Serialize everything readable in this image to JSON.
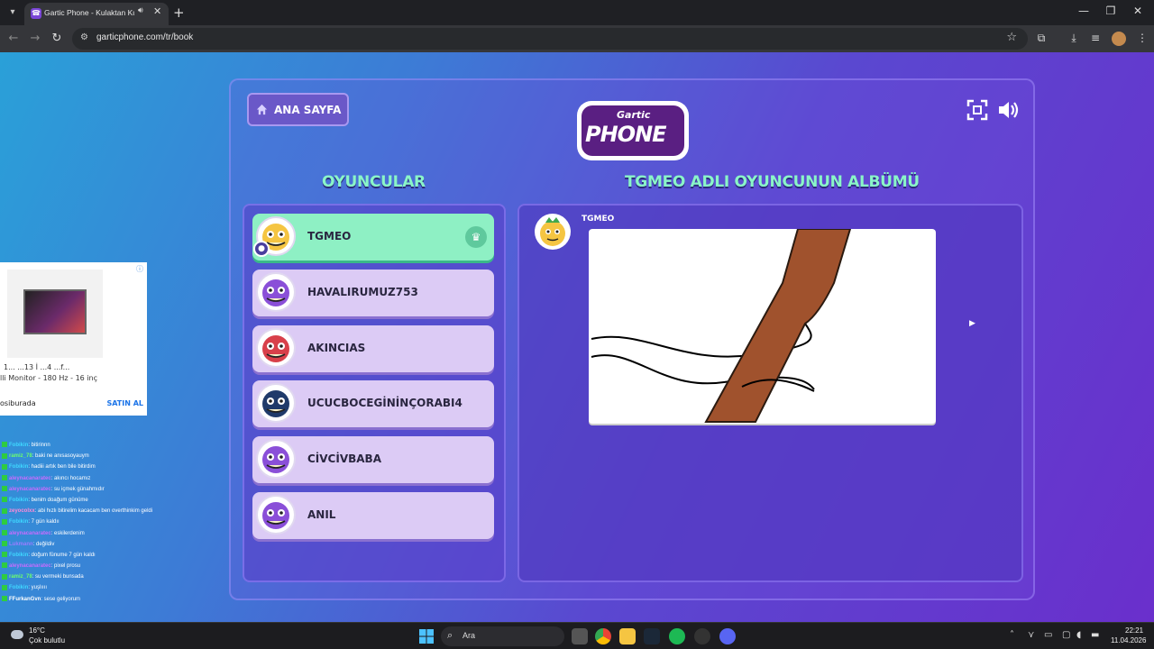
{
  "browser": {
    "tab_title": "Gartic Phone - Kulaktan Kulağa",
    "url": "garticphone.com/tr/book"
  },
  "ad": {
    "text1": "1... ...13 İ ...4 ...f...",
    "text2": "lli Monitor - 180 Hz - 16 inç",
    "source": "osiburada",
    "cta": "SATIN AL",
    "info": "ⓘ"
  },
  "chat": [
    {
      "user": "Fobikin",
      "msg": ": bitirinnn",
      "color": "#3fd8ff"
    },
    {
      "user": "ramiz_78",
      "msg": ": baki ne anısasoyauym",
      "color": "#6cff6c"
    },
    {
      "user": "Fobikin",
      "msg": ": hadiii artık ben bile bitirdim",
      "color": "#3fd8ff"
    },
    {
      "user": "aleynacanaratec",
      "msg": ": akıncı hocamız",
      "color": "#c86cff"
    },
    {
      "user": "aleynacanaratec",
      "msg": ": su içmek günahmıdır",
      "color": "#c86cff"
    },
    {
      "user": "Fobikin",
      "msg": ": benim doağum günüme",
      "color": "#3fd8ff"
    },
    {
      "user": "zeyocolxx",
      "msg": ": abi hızlı bitirelim kacacam ben overthinkim geldi",
      "color": "#ff8ad8"
    },
    {
      "user": "Fobikin",
      "msg": ": 7 gün kaldıı",
      "color": "#3fd8ff"
    },
    {
      "user": "aleynacanaratec",
      "msg": ": eskilerdenim",
      "color": "#c86cff"
    },
    {
      "user": "Lukmann",
      "msg": ": değildiv",
      "color": "#9a7cff"
    },
    {
      "user": "Fobikin",
      "msg": ": doğum fünume 7 gün kaldı",
      "color": "#3fd8ff"
    },
    {
      "user": "aleynacanaratec",
      "msg": ": pixel prosu",
      "color": "#c86cff"
    },
    {
      "user": "ramiz_78",
      "msg": ": su vermeki bunsada",
      "color": "#6cff6c"
    },
    {
      "user": "Fobikin",
      "msg": ": yuşlıııı",
      "color": "#3fd8ff"
    },
    {
      "user": "FFurkanGvn",
      "msg": ": sese geliyorum",
      "color": "#ffffff"
    }
  ],
  "game": {
    "home_label": "ANA SAYFA",
    "logo_top": "Gartic",
    "logo_main": "PHONE",
    "players_title": "OYUNCULAR",
    "album_title": "TGMEO ADLI OYUNCUNUN ALBÜMÜ",
    "album_player": "TGMEO",
    "players": [
      {
        "name": "TGMEO",
        "color": "#f5c542"
      },
      {
        "name": "HAVALIRUMUZ753",
        "color": "#8a4fd8"
      },
      {
        "name": "AKINCIAS",
        "color": "#d8404a"
      },
      {
        "name": "UCUCBOCEGİNİNÇORABI4",
        "color": "#1f3a6a"
      },
      {
        "name": "CİVCİVBABA",
        "color": "#8a4fd8"
      },
      {
        "name": "ANIL",
        "color": "#8a4fd8"
      }
    ]
  },
  "taskbar": {
    "temp": "16°C",
    "weather": "Çok bulutlu",
    "search": "Ara",
    "time": "22:21",
    "date": "11.04.2026"
  }
}
